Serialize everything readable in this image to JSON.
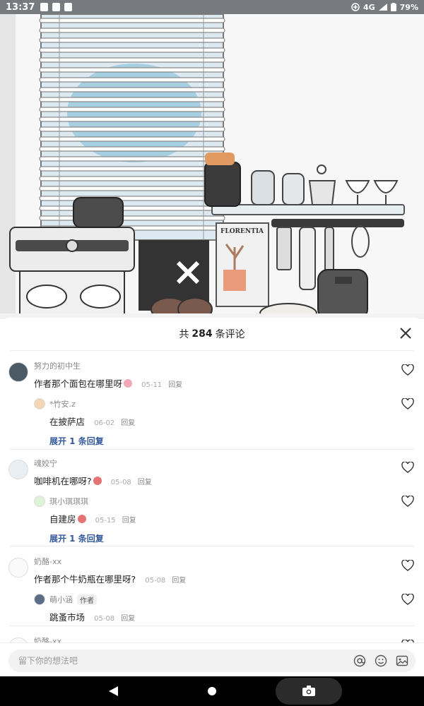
{
  "status_bar": {
    "time": "13:37",
    "network": "4G",
    "battery": "79%"
  },
  "illustration": {
    "brand_text": "FLORENTIA"
  },
  "sheet": {
    "title_prefix": "共",
    "title_count": "284",
    "title_suffix": "条评论"
  },
  "comments": [
    {
      "user": "努力的初中生",
      "text": "作者那个面包在哪里呀",
      "date": "05-11",
      "reply_label": "回复",
      "reply": {
        "user": "*竹安.z",
        "text": "在披萨店",
        "date": "06-02",
        "reply_label": "回复"
      },
      "expand_label": "展开 1 条回复"
    },
    {
      "user": "魂姣宁",
      "text": "咖啡机在哪呀?",
      "date": "05-08",
      "reply_label": "回复",
      "reply": {
        "user": "琪小琪琪琪",
        "text": "自建房",
        "date": "05-15",
        "reply_label": "回复"
      },
      "expand_label": "展开 1 条回复"
    },
    {
      "user": "奶酪-xx",
      "text": "作者那个牛奶瓶在哪里呀?",
      "date": "05-08",
      "reply_label": "回复",
      "reply": {
        "user": "萌小涵",
        "badge": "作者",
        "text": "跳蚤市场",
        "date": "05-08",
        "reply_label": "回复"
      }
    },
    {
      "user": "奶酪-xx"
    }
  ],
  "input": {
    "placeholder": "留下你的想法吧"
  },
  "colors": {
    "expand_link": "#355a9c",
    "status_bar_bg": "#777b80",
    "nav_bg": "#000000"
  },
  "icons": [
    "close-icon",
    "heart-outline-icon",
    "at-icon",
    "emoji-icon",
    "image-icon",
    "back-icon",
    "home-icon",
    "camera-icon"
  ]
}
